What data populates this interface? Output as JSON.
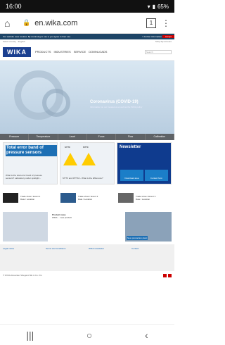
{
  "statusbar": {
    "time": "16:00",
    "battery": "65%"
  },
  "browser": {
    "url": "en.wika.com",
    "tab_count": "1"
  },
  "cookie": {
    "text": "Our website uses cookies. By continuing to use it, you agree to their use.",
    "more": "> Further information",
    "accept": "Accept"
  },
  "util": {
    "left": "Select country  ·  English",
    "right": "Shop   My account"
  },
  "header": {
    "logo": "WIKA",
    "nav": [
      "PRODUCTS",
      "INDUSTRIES",
      "SERVICE",
      "DOWNLOADS"
    ],
    "search_placeholder": "Search"
  },
  "hero": {
    "title": "Coronavirus (COVID-19)",
    "subtitle": "Information on our measures as well as the WIKA policy"
  },
  "categories": [
    "Pressure",
    "Temperature",
    "Level",
    "Force",
    "Flow",
    "Calibration"
  ],
  "promo1": {
    "title": "Total error band of pressure sensors",
    "caption": "What is the total error band of pressure sensors? Laboratory under spotlight..."
  },
  "promo2": {
    "sil_left": "MTTF",
    "sil_right": "MTTF",
    "caption": "MTTF and MTTFd - What is the difference?"
  },
  "promo3": {
    "title": "Newsletter",
    "tile1": "Download area",
    "tile2": "Contact form"
  },
  "events": [
    {
      "title": "Trade show / Event 1",
      "date": "Date / Location"
    },
    {
      "title": "Trade show / Event 2",
      "date": "Date / Location"
    },
    {
      "title": "Trade show / Event 3",
      "date": "Date / Location"
    }
  ],
  "news": {
    "title": "Product news",
    "text": "WIKA ... new product"
  },
  "building": {
    "label": "New production plant"
  },
  "footer": {
    "col1": "Legal notice",
    "col2": "Terms and conditions",
    "col3": "WIKA newsletter",
    "col4": "Contact"
  },
  "copyright": "© WIKA Alexander Wiegand SE & Co. KG"
}
